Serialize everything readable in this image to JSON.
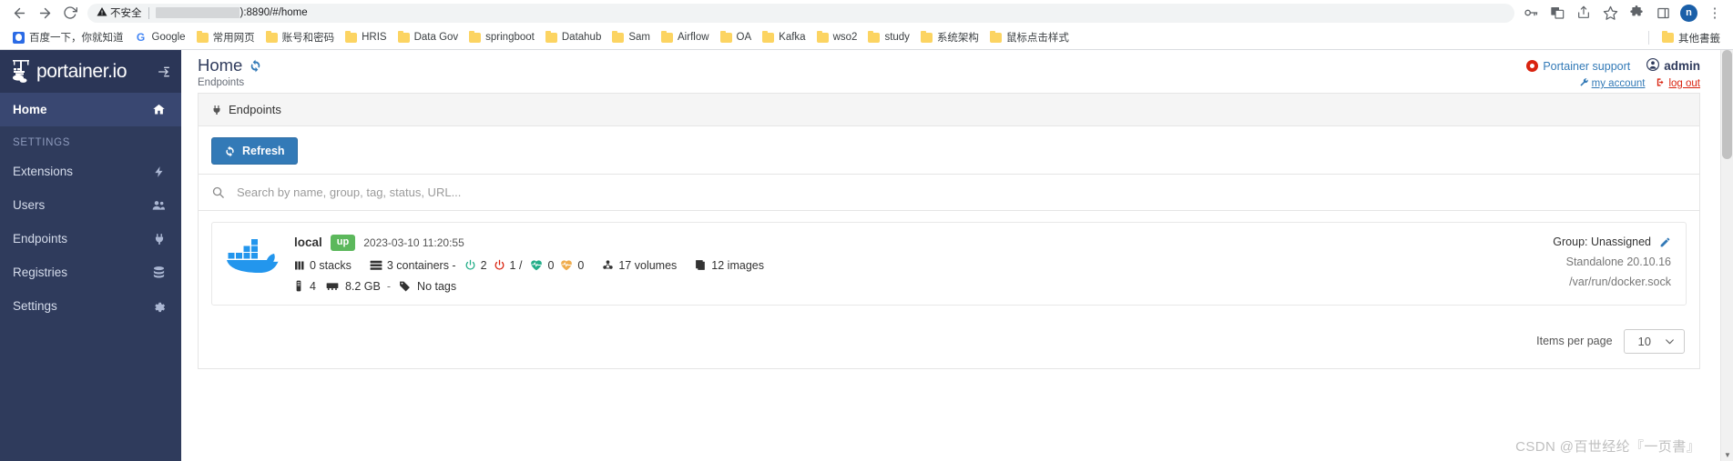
{
  "browser": {
    "nav": {
      "back": "back-arrow",
      "forward": "forward-arrow",
      "reload": "reload"
    },
    "omnibox": {
      "security_label": "不安全",
      "url_visible": "):8890/#/home"
    },
    "toolbar_icons": [
      "key-icon",
      "translate-icon",
      "share-icon",
      "star-icon",
      "extensions-icon",
      "side-panel-icon"
    ],
    "profile_initial": "n",
    "menu": "⋮",
    "bookmarks": [
      {
        "label": "百度一下，你就知道",
        "icon": "baidu-icon"
      },
      {
        "label": "Google",
        "icon": "google-icon"
      },
      {
        "label": "常用网页",
        "icon": "folder-icon"
      },
      {
        "label": "账号和密码",
        "icon": "folder-icon"
      },
      {
        "label": "HRIS",
        "icon": "folder-icon"
      },
      {
        "label": "Data Gov",
        "icon": "folder-icon"
      },
      {
        "label": "springboot",
        "icon": "folder-icon"
      },
      {
        "label": "Datahub",
        "icon": "folder-icon"
      },
      {
        "label": "Sam",
        "icon": "folder-icon"
      },
      {
        "label": "Airflow",
        "icon": "folder-icon"
      },
      {
        "label": "OA",
        "icon": "folder-icon"
      },
      {
        "label": "Kafka",
        "icon": "folder-icon"
      },
      {
        "label": "wso2",
        "icon": "folder-icon"
      },
      {
        "label": "study",
        "icon": "folder-icon"
      },
      {
        "label": "系统架构",
        "icon": "folder-icon"
      },
      {
        "label": "鼠标点击样式",
        "icon": "folder-icon"
      }
    ],
    "other_bookmarks": "其他書籤"
  },
  "sidebar": {
    "brand": "portainer.io",
    "toggle_icon": "collapse-sidebar-icon",
    "items": [
      {
        "label": "Home",
        "icon": "home-icon",
        "active": true
      }
    ],
    "section_label": "SETTINGS",
    "settings_items": [
      {
        "label": "Extensions",
        "icon": "bolt-icon"
      },
      {
        "label": "Users",
        "icon": "users-icon"
      },
      {
        "label": "Endpoints",
        "icon": "plug-icon"
      },
      {
        "label": "Registries",
        "icon": "database-icon"
      },
      {
        "label": "Settings",
        "icon": "gear-icon"
      }
    ]
  },
  "header": {
    "title": "Home",
    "refresh_icon": "refresh-icon",
    "subtitle": "Endpoints",
    "support_label": "Portainer support",
    "support_icon": "life-ring-icon",
    "user_label": "admin",
    "user_icon": "user-circle-icon",
    "my_account_label": "my account",
    "my_account_icon": "wrench-icon",
    "logout_label": "log out",
    "logout_icon": "sign-out-icon"
  },
  "panel": {
    "title": "Endpoints",
    "title_icon": "plug-icon",
    "refresh_button": "Refresh",
    "refresh_button_icon": "sync-icon",
    "search_icon": "search-icon",
    "search_placeholder": "Search by name, group, tag, status, URL...",
    "search_value": ""
  },
  "endpoint": {
    "logo": "docker-whale-icon",
    "name": "local",
    "status_badge": "up",
    "timestamp": "2023-03-10 11:20:55",
    "stats": [
      {
        "icon": "stacks-icon",
        "value": "0 stacks"
      },
      {
        "icon": "containers-icon",
        "value": "3 containers -"
      },
      {
        "icon": "power-running-icon",
        "value": "2"
      },
      {
        "icon": "power-stopped-icon",
        "value": "1 /"
      },
      {
        "icon": "heartbeat-healthy-icon",
        "value": "0"
      },
      {
        "icon": "heartbeat-unhealthy-icon",
        "value": "0"
      },
      {
        "icon": "volumes-icon",
        "value": "17 volumes"
      },
      {
        "icon": "images-icon",
        "value": "12 images"
      }
    ],
    "resources": [
      {
        "icon": "cpu-icon",
        "value": "4"
      },
      {
        "icon": "memory-icon",
        "value": "8.2 GB"
      },
      {
        "icon": "dash",
        "value": "-"
      },
      {
        "icon": "tag-icon",
        "value": "No tags"
      }
    ],
    "group": "Group: Unassigned",
    "group_edit_icon": "pencil-icon",
    "docker_version": "Standalone 20.10.16",
    "socket": "/var/run/docker.sock"
  },
  "pager": {
    "label": "Items per page",
    "value": "10",
    "chevron_icon": "chevron-down-icon"
  },
  "watermark": "CSDN @百世经纶『一页書』",
  "colors": {
    "sidebar_bg": "#2f3b5c",
    "primary": "#337ab7",
    "success": "#5cb85c",
    "danger": "#d9230f"
  }
}
